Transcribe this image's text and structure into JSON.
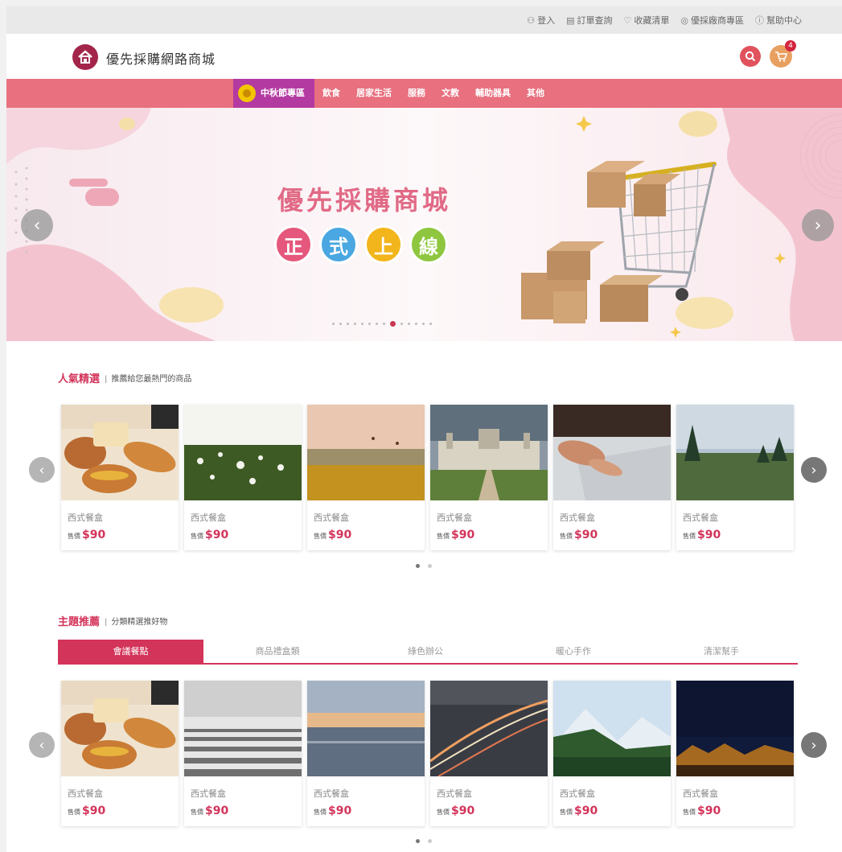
{
  "topbar": {
    "links": [
      {
        "icon": "user-icon",
        "glyph": "⚇",
        "label": "登入"
      },
      {
        "icon": "order-icon",
        "glyph": "▤",
        "label": "訂單查詢"
      },
      {
        "icon": "heart-icon",
        "glyph": "♡",
        "label": "收藏清單"
      },
      {
        "icon": "store-icon",
        "glyph": "◎",
        "label": "優採廠商專區"
      },
      {
        "icon": "help-icon",
        "glyph": "ⓘ",
        "label": "幫助中心"
      }
    ]
  },
  "header": {
    "title": "優先採購網路商城",
    "cart_count": "4",
    "colors": {
      "logo": "#a3264a",
      "search": "#e0525c",
      "cart": "#e8a060"
    }
  },
  "nav": {
    "featured_label": "中秋節專區",
    "items": [
      "飲食",
      "居家生活",
      "服務",
      "文教",
      "輔助器具",
      "其他"
    ],
    "colors": {
      "bar": "#e8707f",
      "featured": "#b33aa1"
    }
  },
  "banner": {
    "title": "優先採購商城",
    "badges": [
      {
        "char": "正",
        "color": "#e5577c"
      },
      {
        "char": "式",
        "color": "#4aa7e1"
      },
      {
        "char": "上",
        "color": "#f2b51c"
      },
      {
        "char": "線",
        "color": "#8ec63f"
      }
    ],
    "prev_glyph": "‹",
    "next_glyph": "›",
    "slide_count": 14,
    "active_slide": 8
  },
  "popular": {
    "title": "人氣精選",
    "subtitle": "推薦給您最熱門的商品",
    "items": [
      {
        "name": "西式餐盒",
        "price_label": "售價",
        "price": "$90",
        "scene": "bread"
      },
      {
        "name": "西式餐盒",
        "price_label": "售價",
        "price": "$90",
        "scene": "meadow"
      },
      {
        "name": "西式餐盒",
        "price_label": "售價",
        "price": "$90",
        "scene": "sunset-field"
      },
      {
        "name": "西式餐盒",
        "price_label": "售價",
        "price": "$90",
        "scene": "castle"
      },
      {
        "name": "西式餐盒",
        "price_label": "售價",
        "price": "$90",
        "scene": "laptop"
      },
      {
        "name": "西式餐盒",
        "price_label": "售價",
        "price": "$90",
        "scene": "forest"
      }
    ]
  },
  "theme": {
    "title": "主題推薦",
    "subtitle": "分類精選推好物",
    "tabs": [
      "會議餐點",
      "商品禮盒類",
      "綠色辦公",
      "暖心手作",
      "清潔幫手"
    ],
    "active_tab": 0,
    "items": [
      {
        "name": "西式餐盒",
        "price_label": "售價",
        "price": "$90",
        "scene": "bread"
      },
      {
        "name": "西式餐盒",
        "price_label": "售價",
        "price": "$90",
        "scene": "stairs"
      },
      {
        "name": "西式餐盒",
        "price_label": "售價",
        "price": "$90",
        "scene": "sea"
      },
      {
        "name": "西式餐盒",
        "price_label": "售價",
        "price": "$90",
        "scene": "road"
      },
      {
        "name": "西式餐盒",
        "price_label": "售價",
        "price": "$90",
        "scene": "mountain"
      },
      {
        "name": "西式餐盒",
        "price_label": "售價",
        "price": "$90",
        "scene": "night"
      }
    ]
  },
  "arrows": {
    "prev": "‹",
    "next": "›"
  },
  "accent": "#d3345a"
}
